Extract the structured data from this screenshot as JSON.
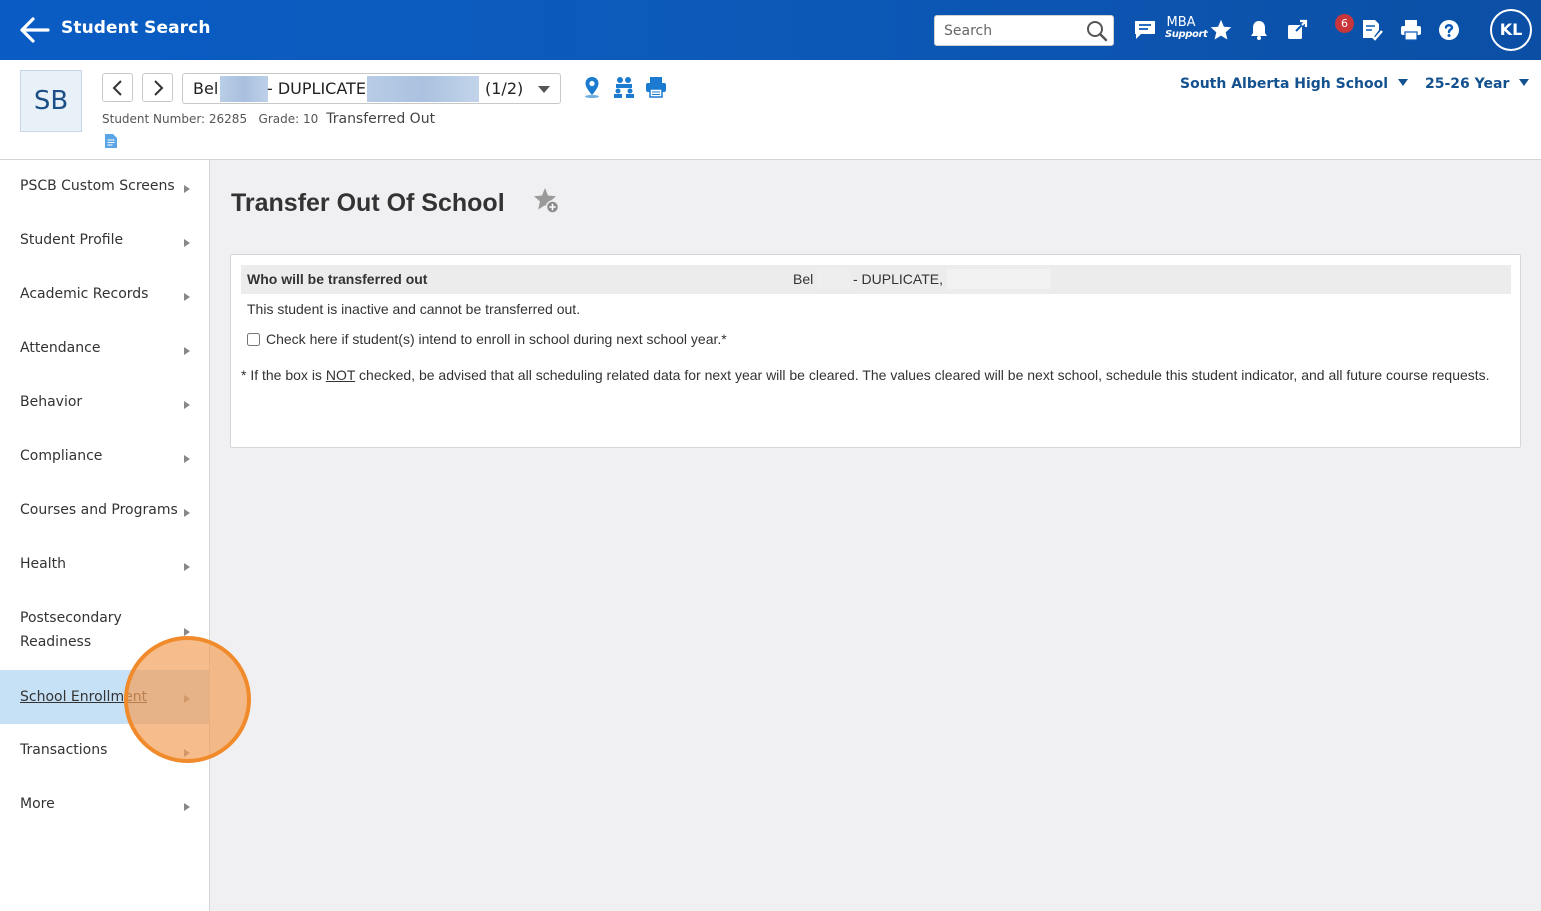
{
  "topbar": {
    "title": "Student Search",
    "search_placeholder": "Search",
    "mba_line1": "MBA",
    "mba_line2": "Support",
    "notification_count": "6",
    "user_initials": "KL",
    "icons": [
      "back-arrow-icon",
      "search-icon",
      "messages-icon",
      "star-icon",
      "bell-icon",
      "external-link-icon",
      "tasks-icon",
      "print-icon",
      "help-icon"
    ]
  },
  "student": {
    "initials": "SB",
    "name_first_part": "Bel",
    "name_middle": "- DUPLICATE,",
    "position": "(1/2)",
    "meta": "Student Number: 26285   Grade: 10",
    "status": "Transferred Out",
    "school": "South Alberta High School",
    "year": "25-26 Year"
  },
  "sidebar": {
    "items": [
      {
        "label": "PSCB Custom Screens"
      },
      {
        "label": "Student Profile"
      },
      {
        "label": "Academic Records"
      },
      {
        "label": "Attendance"
      },
      {
        "label": "Behavior"
      },
      {
        "label": "Compliance"
      },
      {
        "label": "Courses and Programs"
      },
      {
        "label": "Health"
      },
      {
        "label": "Postsecondary Readiness"
      },
      {
        "label": "School Enrollment"
      },
      {
        "label": "Transactions"
      },
      {
        "label": "More"
      }
    ],
    "active_item": "School Enrollment"
  },
  "main": {
    "title": "Transfer Out Of School",
    "row_label": "Who will be transferred out",
    "row_value_a": "Bel",
    "row_value_b": "- DUPLICATE,",
    "inactive_message": "This student is inactive and cannot be transferred out.",
    "checkbox_label": "Check here if student(s) intend to enroll in school during next school year.*",
    "note_prefix": "* If the box is ",
    "note_emph": "NOT",
    "note_suffix": " checked, be advised that all scheduling related data for next year will be cleared. The values cleared will be next school, schedule this student indicator, and all future course requests."
  },
  "colors": {
    "topbar": "#0b59b8",
    "link": "#14518f",
    "active_nav": "#c6e0f6",
    "click_marker": "#f08a2a",
    "badge": "#c8353b"
  }
}
